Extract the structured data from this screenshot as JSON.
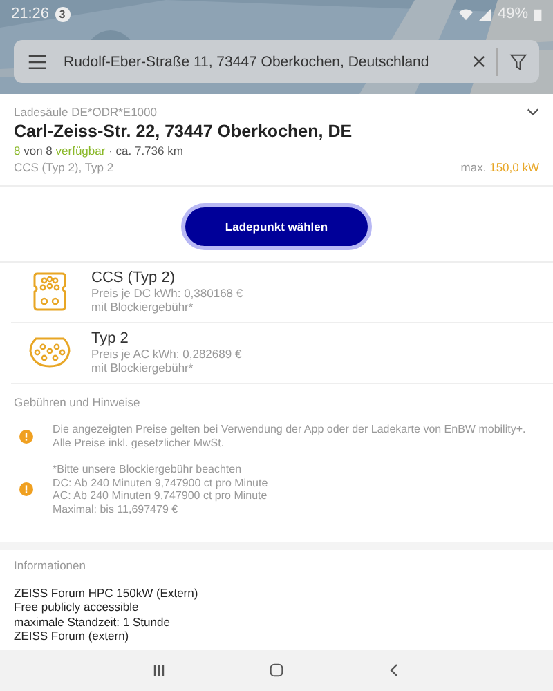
{
  "status_bar": {
    "time": "21:26",
    "notification_count": "3",
    "battery": "49%"
  },
  "search": {
    "value": "Rudolf-Eber-Straße 11, 73447 Oberkochen, Deutschland"
  },
  "station": {
    "id": "Ladesäule DE*ODR*E1000",
    "address": "Carl-Zeiss-Str. 22, 73447 Oberkochen, DE",
    "available": "8",
    "of_total": "von 8",
    "available_label": "verfügbar",
    "distance": "· ca. 7.736 km",
    "connectors_summary": "CCS (Typ 2), Typ 2",
    "max_label": "max.",
    "max_power": "150,0 kW"
  },
  "primary_button": "Ladepunkt wählen",
  "connectors": [
    {
      "kind": "ccs",
      "name": "CCS (Typ 2)",
      "price": "Preis je DC kWh: 0,380168 €",
      "note": "mit Blockiergebühr*"
    },
    {
      "kind": "type2",
      "name": "Typ 2",
      "price": "Preis je AC kWh: 0,282689 €",
      "note": "mit Blockiergebühr*"
    }
  ],
  "fees": {
    "heading": "Gebühren und Hinweise",
    "notes": [
      {
        "lines": [
          "Die angezeigten Preise gelten bei Verwendung der App oder der Ladekarte von EnBW mobility+. Alle Preise inkl. gesetzlicher MwSt."
        ]
      },
      {
        "lines": [
          "*Bitte unsere Blockiergebühr beachten",
          "DC: Ab 240 Minuten 9,747900 ct pro Minute",
          "AC: Ab 240 Minuten 9,747900 ct pro Minute",
          "Maximal: bis 11,697479 €"
        ]
      }
    ]
  },
  "info": {
    "heading": "Informationen",
    "lines": [
      "ZEISS Forum HPC 150kW (Extern)",
      "Free publicly accessible",
      "maximale Standzeit: 1 Stunde",
      "ZEISS Forum (extern)"
    ]
  }
}
